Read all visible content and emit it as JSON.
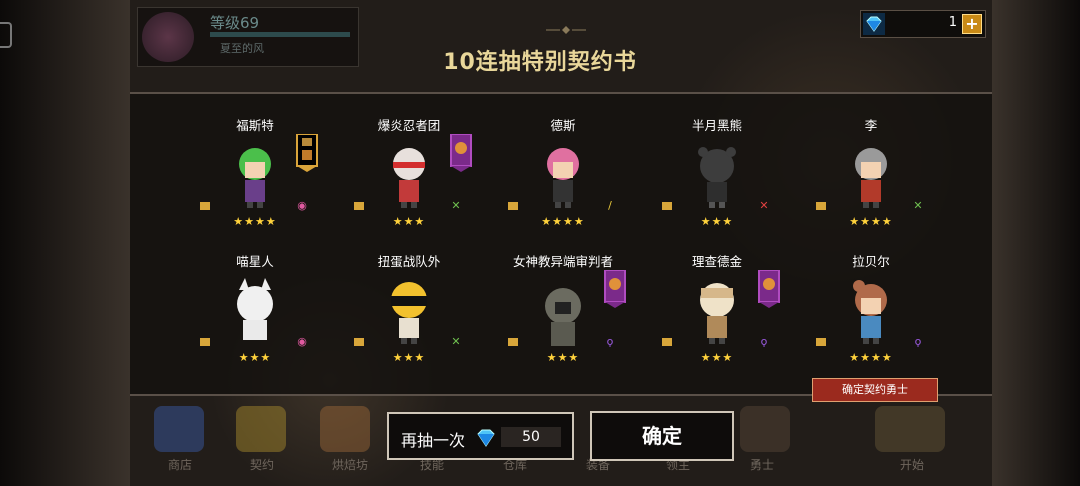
{
  "player": {
    "level": "等级69",
    "name": "夏至的风"
  },
  "currency": {
    "gems": "1",
    "icon": "diamond-icon",
    "plus": "+"
  },
  "dialog": {
    "title": "10连抽特别契约书"
  },
  "heroes": [
    {
      "name": "福斯特",
      "stars": "★★★★",
      "element": "earth",
      "banner": true
    },
    {
      "name": "爆炎忍者团",
      "stars": "★★★",
      "element": "earth",
      "banner": true
    },
    {
      "name": "德斯",
      "stars": "★★★★",
      "element": "light",
      "banner": false
    },
    {
      "name": "半月黑熊",
      "stars": "★★★",
      "element": "fire",
      "banner": false
    },
    {
      "name": "李",
      "stars": "★★★★",
      "element": "earth",
      "banner": false
    },
    {
      "name": "喵星人",
      "stars": "★★★",
      "element": "water",
      "banner": false
    },
    {
      "name": "扭蛋战队外",
      "stars": "★★★",
      "element": "earth",
      "banner": false
    },
    {
      "name": "女神教异端审判者",
      "stars": "★★★",
      "element": "dark",
      "banner": true
    },
    {
      "name": "理查德金",
      "stars": "★★★",
      "element": "dark",
      "banner": true
    },
    {
      "name": "拉贝尔",
      "stars": "★★★★",
      "element": "dark",
      "banner": false
    }
  ],
  "confirm_tag": "确定契约勇士",
  "actions": {
    "again_label": "再抽一次",
    "again_cost": "50",
    "ok_label": "确定"
  },
  "nav": [
    "商店",
    "契约",
    "烘焙坊",
    "技能",
    "仓库",
    "装备",
    "领主",
    "勇士",
    "开始"
  ],
  "colors": {
    "title": "#e9d79a",
    "stars": "#ffd23c",
    "confirm_tag": "#9b2a1e"
  }
}
